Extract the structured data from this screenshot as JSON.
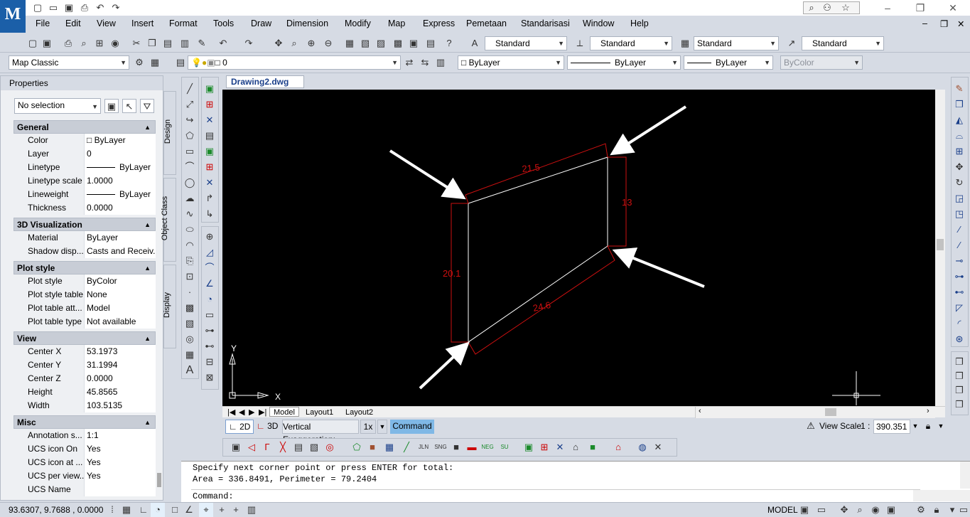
{
  "title_bar": {
    "app_logo": "M",
    "quick_access_icons": [
      "new-icon",
      "open-icon",
      "save-icon",
      "print-icon",
      "undo-icon",
      "redo-icon"
    ],
    "search_icons": [
      "search-icon",
      "user-icon",
      "star-icon"
    ],
    "window_buttons": [
      "–",
      "❐",
      "✕"
    ]
  },
  "menu": {
    "items": [
      "File",
      "Edit",
      "View",
      "Insert",
      "Format",
      "Tools",
      "Draw",
      "Dimension",
      "Modify",
      "Map",
      "Express",
      "Pemetaan",
      "Standarisasi",
      "Window",
      "Help"
    ],
    "doc_buttons": [
      "–",
      "❐",
      "✕"
    ]
  },
  "styles_toolbar": {
    "text_style": "Standard",
    "dim_style": "Standard",
    "table_style": "Standard",
    "multileader_style": "Standard"
  },
  "workspace_toolbar": {
    "workspace": "Map Classic",
    "layer": "0",
    "color": "ByLayer",
    "linetype": "ByLayer",
    "lineweight": "ByLayer",
    "plotstyle": "ByColor"
  },
  "properties": {
    "title": "Properties",
    "selection": "No selection",
    "sections": [
      {
        "name": "General",
        "rows": [
          [
            "Color",
            "ByLayer"
          ],
          [
            "Layer",
            "0"
          ],
          [
            "Linetype",
            "ByLayer"
          ],
          [
            "Linetype scale",
            "1.0000"
          ],
          [
            "Lineweight",
            "ByLayer"
          ],
          [
            "Thickness",
            "0.0000"
          ]
        ]
      },
      {
        "name": "3D Visualization",
        "rows": [
          [
            "Material",
            "ByLayer"
          ],
          [
            "Shadow disp...",
            "Casts and Receiv..."
          ]
        ]
      },
      {
        "name": "Plot style",
        "rows": [
          [
            "Plot style",
            "ByColor"
          ],
          [
            "Plot style table",
            "None"
          ],
          [
            "Plot table att...",
            "Model"
          ],
          [
            "Plot table type",
            "Not available"
          ]
        ]
      },
      {
        "name": "View",
        "rows": [
          [
            "Center X",
            "53.1973"
          ],
          [
            "Center Y",
            "31.1994"
          ],
          [
            "Center Z",
            "0.0000"
          ],
          [
            "Height",
            "45.8565"
          ],
          [
            "Width",
            "103.5135"
          ]
        ]
      },
      {
        "name": "Misc",
        "rows": [
          [
            "Annotation s...",
            "1:1"
          ],
          [
            "UCS icon On",
            "Yes"
          ],
          [
            "UCS icon at ...",
            "Yes"
          ],
          [
            "UCS per view...",
            "Yes"
          ],
          [
            "UCS Name",
            ""
          ]
        ]
      }
    ],
    "side_tabs": [
      "Design",
      "Object Class",
      "Display"
    ]
  },
  "drawing": {
    "tab": "Drawing2.dwg",
    "dimensions": {
      "top": "21.5",
      "right": "13",
      "left": "20.1",
      "bottom": "24.6"
    },
    "ucs_x": "X",
    "ucs_y": "Y"
  },
  "layout_tabs": [
    "Model",
    "Layout1",
    "Layout2"
  ],
  "status_row": {
    "btn_2d": "2D",
    "btn_3d": "3D",
    "vert_exag_label": "Vertical Exaggeration:",
    "vert_exag_value": "1x",
    "command_btn": "Command",
    "view_scale_label": "View Scale",
    "view_scale_ratio": "1 :",
    "view_scale_value": "390.351"
  },
  "command": {
    "line1": "Specify next corner point or press ENTER for total:",
    "line2": "Area = 336.8491, Perimeter = 79.2404",
    "prompt": "Command:"
  },
  "bottom_bar": {
    "coords": "93.6307, 9.7688 , 0.0000",
    "model": "MODEL"
  },
  "colors": {
    "dimension": "#cc1010",
    "canvas": "#000000",
    "accent": "#1a3f8a"
  }
}
